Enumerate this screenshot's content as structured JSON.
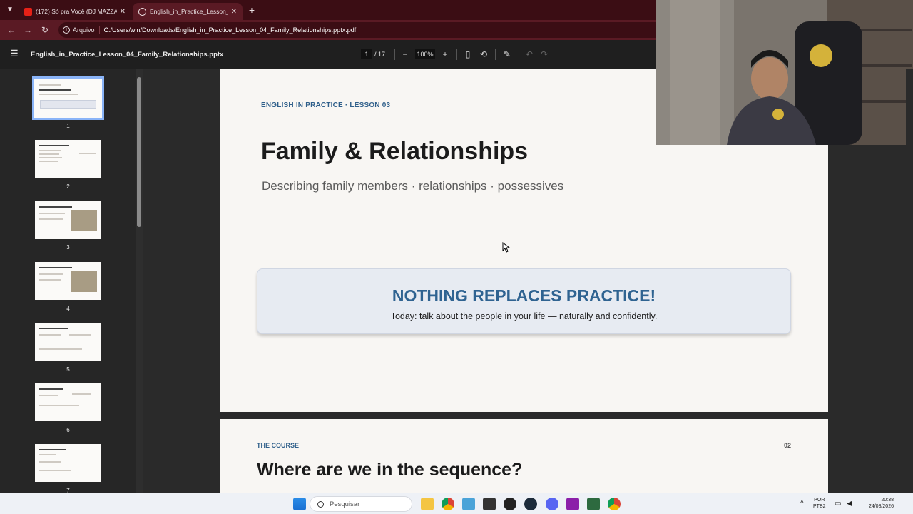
{
  "browser": {
    "tabs": [
      {
        "title": "(172) Só pra Você (DJ MAZZAY",
        "active": false
      },
      {
        "title": "English_in_Practice_Lesson_04_",
        "active": true
      }
    ],
    "address_chip": "Arquivo",
    "url": "C:/Users/win/Downloads/English_in_Practice_Lesson_04_Family_Relationships.pptx.pdf"
  },
  "pdf": {
    "doc_title": "English_in_Practice_Lesson_04_Family_Relationships.pptx",
    "current_page": "1",
    "total_pages": "/ 17",
    "zoom": "100%"
  },
  "thumbnails": [
    "1",
    "2",
    "3",
    "4",
    "5",
    "6",
    "7"
  ],
  "slide1": {
    "eyebrow": "ENGLISH IN PRACTICE · LESSON 03",
    "title": "Family & Relationships",
    "subtitle": "Describing family members · relationships · possessives",
    "callout_heading": "NOTHING REPLACES PRACTICE!",
    "callout_body": "Today: talk about the people in your life — naturally and confidently."
  },
  "slide2": {
    "eyebrow": "THE COURSE",
    "page_number": "02",
    "title": "Where are we in the sequence?"
  },
  "taskbar": {
    "search_placeholder": "Pesquisar",
    "lang_line1": "POR",
    "lang_line2": "PTB2",
    "time": "20:38",
    "date": "24/08/2026"
  },
  "colors": {
    "tabstrip": "#3b0d14",
    "toolbar": "#5a1a24",
    "accent_blue": "#2f6391",
    "thumb_selection": "#8ab4f8"
  }
}
